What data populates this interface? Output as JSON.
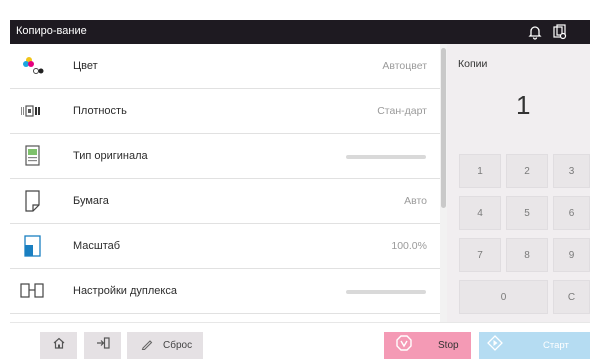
{
  "header": {
    "title": "Копиро-вание",
    "icons": [
      "bell-icon",
      "copy-settings-icon"
    ]
  },
  "menu": {
    "items": [
      {
        "label": "Цвет",
        "value": "Автоцвет",
        "icon": "color-icon"
      },
      {
        "label": "Плотность",
        "value": "Стан-дарт",
        "icon": "density-icon"
      },
      {
        "label": "Тип оригинала",
        "value": "",
        "icon": "original-type-icon"
      },
      {
        "label": "Бумага",
        "value": "Авто",
        "icon": "paper-icon"
      },
      {
        "label": "Масштаб",
        "value": "100.0%",
        "icon": "zoom-icon"
      },
      {
        "label": "Настройки дуплекса",
        "value": "",
        "icon": "duplex-icon"
      }
    ]
  },
  "copies": {
    "label": "Копии",
    "value": "1"
  },
  "keypad": {
    "keys": [
      "1",
      "2",
      "3",
      "4",
      "5",
      "6",
      "7",
      "8",
      "9",
      "0",
      "C"
    ]
  },
  "bottom": {
    "reset_label": "Сброс",
    "stop_label": "Stop",
    "start_label": "Старт"
  },
  "colors": {
    "header_bg": "#1e1a21",
    "stop_bg": "#f49ab5",
    "start_bg": "#b5dcf2",
    "keypad_bg": "#f1eef0"
  }
}
